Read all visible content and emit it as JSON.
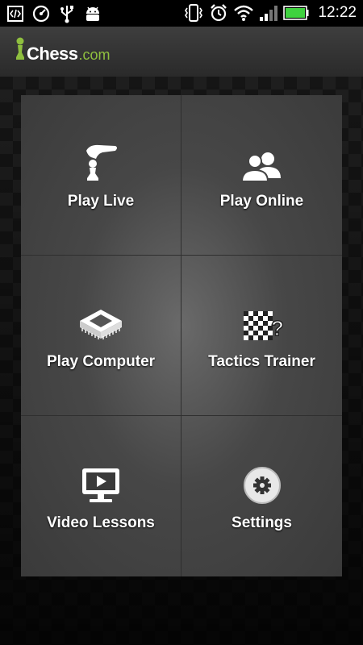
{
  "status_bar": {
    "time": "12:22",
    "left_icons": [
      "code-icon",
      "speedometer-icon",
      "usb-icon",
      "android-icon"
    ],
    "right_icons": [
      "vibrate-icon",
      "alarm-icon",
      "wifi-icon",
      "signal-icon",
      "battery-icon"
    ]
  },
  "header": {
    "logo_text": "Chess",
    "logo_domain": ".com"
  },
  "menu": {
    "items": [
      {
        "label": "Play Live",
        "icon": "play-live-icon"
      },
      {
        "label": "Play Online",
        "icon": "users-icon"
      },
      {
        "label": "Play Computer",
        "icon": "chip-icon"
      },
      {
        "label": "Tactics Trainer",
        "icon": "tactics-board-icon"
      },
      {
        "label": "Video Lessons",
        "icon": "video-monitor-icon"
      },
      {
        "label": "Settings",
        "icon": "gear-icon"
      }
    ]
  },
  "colors": {
    "logo_green": "#8fbf3f",
    "battery_green": "#3fd23f"
  }
}
